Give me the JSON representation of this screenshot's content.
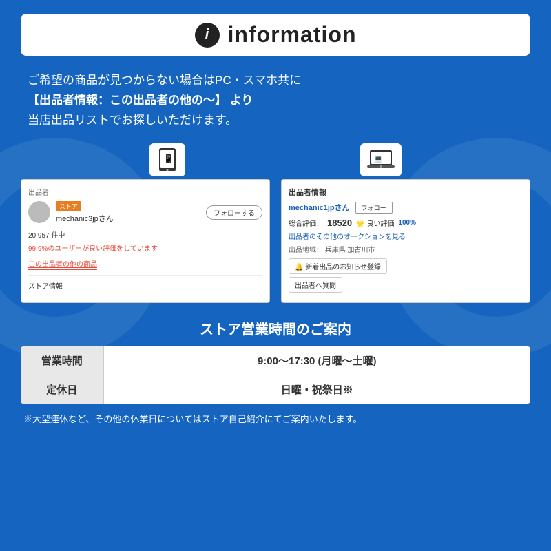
{
  "background_color": "#1565c0",
  "header": {
    "icon_symbol": "i",
    "title": "information"
  },
  "intro": {
    "line1": "ご希望の商品が見つからない場合はPC・スマホ共に",
    "line2": "【出品者情報：この出品者の他の〜】 より",
    "line3": "当店出品リストでお探しいただけます。"
  },
  "left_screenshot": {
    "section": "出品者",
    "store_badge": "ストア",
    "seller_name": "mechanic3jpさん",
    "follow_btn": "フォローする",
    "count": "20,957 件中",
    "rating_text": "99.9%のユーザーが良い評価をしています",
    "link_text": "この出品者の他の商品",
    "store_info": "ストア情報"
  },
  "right_screenshot": {
    "section": "出品者情報",
    "seller_name": "mechanic1jpさん",
    "follow_btn": "フォロー",
    "total_label": "総合評価：",
    "total_num": "18520",
    "good_label": "🌟 良い評価",
    "good_pct": "100%",
    "auction_link": "出品者のその他のオークションを見る",
    "location_label": "出品地域：",
    "location": "兵庫県 加古川市",
    "notify_btn": "🔔 新着出品のお知らせ登録",
    "question_btn": "出品者へ質問"
  },
  "hours": {
    "title": "ストア営業時間のご案内",
    "rows": [
      {
        "label": "営業時間",
        "value": "9:00〜17:30 (月曜〜土曜)"
      },
      {
        "label": "定休日",
        "value": "日曜・祝祭日※"
      }
    ],
    "footnote": "※大型連休など、その他の休業日についてはストア自己紹介にてご案内いたします。"
  }
}
